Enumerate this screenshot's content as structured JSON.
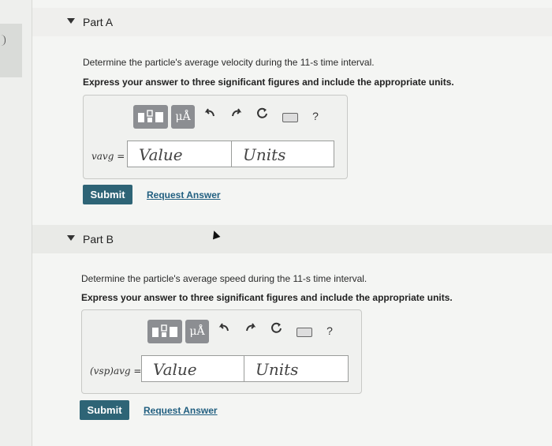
{
  "part_a": {
    "label": "Part A",
    "question": "Determine the particle's average velocity during the 11-s time interval.",
    "instruction": "Express your answer to three significant figures and include the appropriate units.",
    "toolbar": {
      "units_label": "μÅ",
      "help_label": "?"
    },
    "var_label": "vavg =",
    "value_placeholder": "Value",
    "units_placeholder": "Units",
    "submit_label": "Submit",
    "request_label": "Request Answer"
  },
  "part_b": {
    "label": "Part B",
    "question": "Determine the particle's average speed during the 11-s time interval.",
    "instruction": "Express your answer to three significant figures and include the appropriate units.",
    "toolbar": {
      "units_label": "μÅ",
      "help_label": "?"
    },
    "var_label": "(vsp)avg =",
    "value_placeholder": "Value",
    "units_placeholder": "Units",
    "submit_label": "Submit",
    "request_label": "Request Answer"
  },
  "icons": [
    "templates-icon",
    "undo-icon",
    "redo-icon",
    "reset-icon",
    "keyboard-icon",
    "help-icon",
    "collapse-triangle-icon"
  ],
  "colors": {
    "submit_bg": "#2e6476",
    "link": "#215f80",
    "toolbar_btn": "#8c8e92"
  }
}
